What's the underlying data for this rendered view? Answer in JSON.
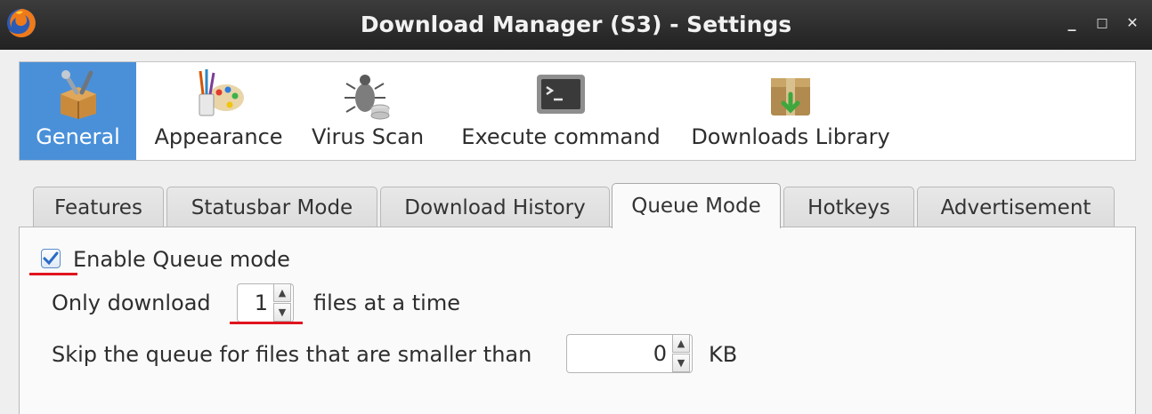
{
  "window": {
    "title": "Download Manager (S3) - Settings",
    "controls": {
      "minimize": "_",
      "maximize": "□",
      "close": "✕"
    },
    "app_icon": "firefox-icon"
  },
  "categories": [
    {
      "label": "General",
      "icon": "general-tools-icon",
      "active": true
    },
    {
      "label": "Appearance",
      "icon": "appearance-palette-icon",
      "active": false
    },
    {
      "label": "Virus Scan",
      "icon": "virus-scan-bug-icon",
      "active": false
    },
    {
      "label": "Execute command",
      "icon": "terminal-icon",
      "active": false
    },
    {
      "label": "Downloads Library",
      "icon": "downloads-library-box-icon",
      "active": false
    }
  ],
  "tabs": [
    {
      "label": "Features",
      "active": false
    },
    {
      "label": "Statusbar Mode",
      "active": false
    },
    {
      "label": "Download History",
      "active": false
    },
    {
      "label": "Queue Mode",
      "active": true
    },
    {
      "label": "Hotkeys",
      "active": false
    },
    {
      "label": "Advertisement",
      "active": false
    }
  ],
  "queue": {
    "enable_label": "Enable Queue mode",
    "enable_checked": true,
    "only_download_prefix": "Only download",
    "files_count": "1",
    "only_download_suffix": "files at a time",
    "skip_label": "Skip the queue for files that are smaller than",
    "skip_value": "0",
    "skip_unit": "KB"
  },
  "colors": {
    "accent": "#4a90d9",
    "annotation_underline": "#e0141e"
  }
}
